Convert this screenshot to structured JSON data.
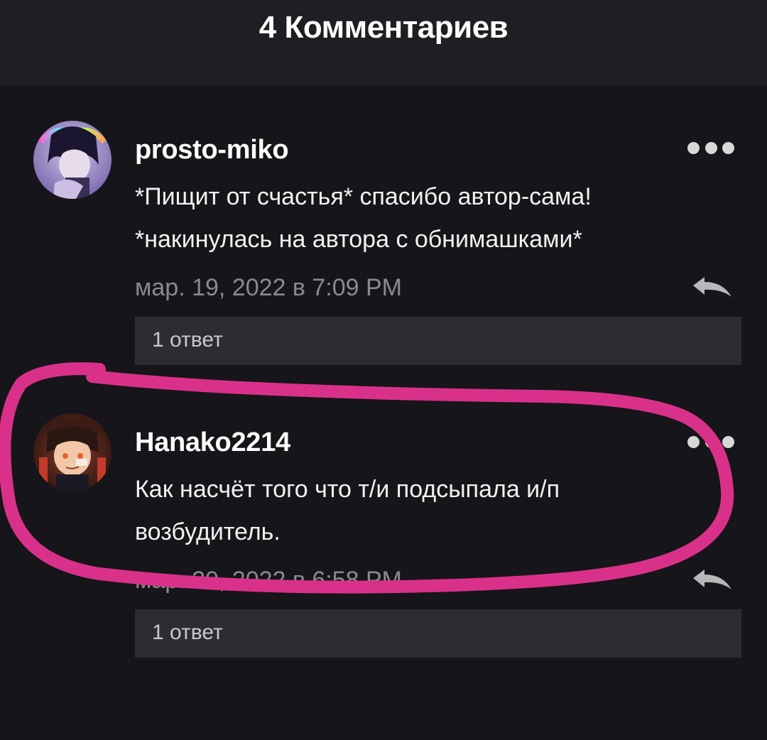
{
  "header": {
    "title": "4 Комментариев"
  },
  "comments": [
    {
      "username": "prosto-miko",
      "text_lines": [
        "*Пищит от счастья* спасибо автор-сама!",
        "*накинулась на автора с обнимашками*"
      ],
      "timestamp": "мар. 19, 2022 в 7:09 PM",
      "replies_label": "1 ответ",
      "more_icon": "more-horizontal-icon",
      "reply_icon": "reply-arrow-icon"
    },
    {
      "username": "Hanako2214",
      "text_lines": [
        "Как насчёт того что т/и подсыпала и/п",
        "возбудитель."
      ],
      "timestamp": "мар. 20, 2022 в 6:58 PM",
      "replies_label": "1 ответ",
      "more_icon": "more-horizontal-icon",
      "reply_icon": "reply-arrow-icon"
    }
  ],
  "annotation": {
    "color": "#d9318a"
  },
  "colors": {
    "background": "#161519",
    "header": "#1f1e22",
    "reply_box": "#2d2c30",
    "muted_text": "#8a8a8e"
  }
}
